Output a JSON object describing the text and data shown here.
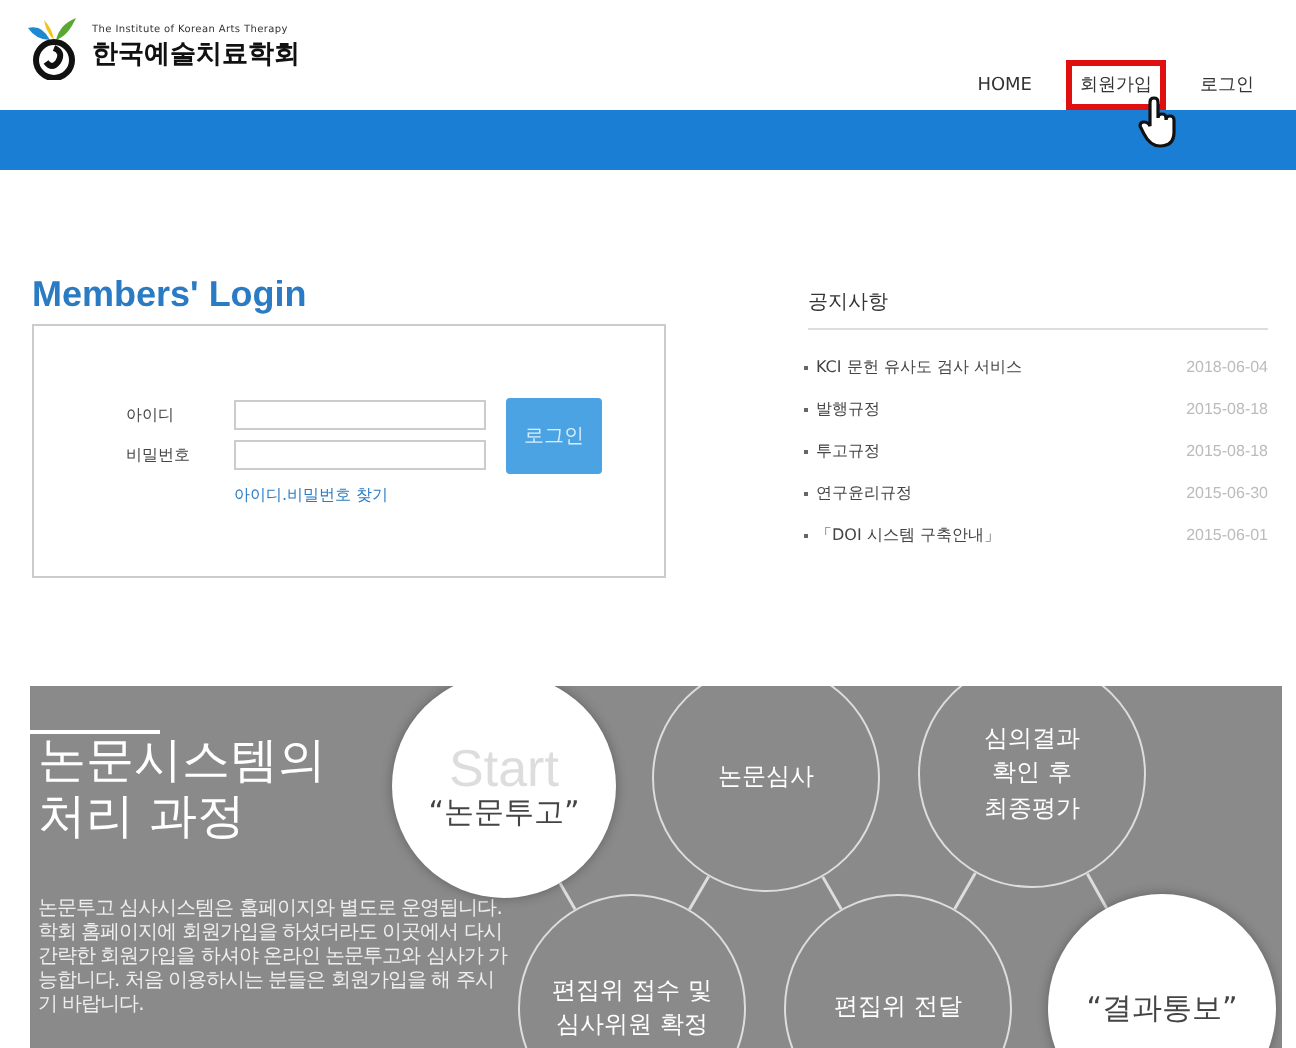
{
  "header": {
    "logo_caption": "The Institute of Korean Arts Therapy",
    "logo_name": "한국예술치료학회",
    "nav": [
      {
        "label": "HOME",
        "highlighted": false
      },
      {
        "label": "회원가입",
        "highlighted": true
      },
      {
        "label": "로그인",
        "highlighted": false
      }
    ]
  },
  "login": {
    "title": "Members' Login",
    "fields": [
      {
        "label": "아이디"
      },
      {
        "label": "비밀번호"
      }
    ],
    "button": "로그인",
    "find_link": "아이디.비밀번호 찾기"
  },
  "notices": {
    "title": "공지사항",
    "items": [
      {
        "title": "KCI 문헌 유사도 검사 서비스",
        "date": "2018-06-04"
      },
      {
        "title": "발행규정",
        "date": "2015-08-18"
      },
      {
        "title": "투고규정",
        "date": "2015-08-18"
      },
      {
        "title": "연구윤리규정",
        "date": "2015-06-30"
      },
      {
        "title": "「DOI 시스템 구축안내」",
        "date": "2015-06-01"
      }
    ]
  },
  "process": {
    "title": "논문시스템의\n처리 과정",
    "description": "논문투고 심사시스템은 홈페이지와 별도로 운영됩니다. 학회 홈페이지에 회원가입을 하셨더라도 이곳에서 다시 간략한 회원가입을 하셔야 온라인 논문투고와 심사가 가능합니다. 처음 이용하시는 분들은 회원가입을 해 주시기 바랍니다.",
    "steps": [
      {
        "kind": "filled",
        "label": "“논문투고”",
        "backdrop": "Start"
      },
      {
        "kind": "outline",
        "label": "논문심사"
      },
      {
        "kind": "outline",
        "label": "심의결과\n확인 후\n최종평가"
      },
      {
        "kind": "outline",
        "label": "편집위 접수 및\n심사위원 확정"
      },
      {
        "kind": "outline",
        "label": "편집위 전달"
      },
      {
        "kind": "filled",
        "label": "“결과통보”"
      }
    ]
  }
}
